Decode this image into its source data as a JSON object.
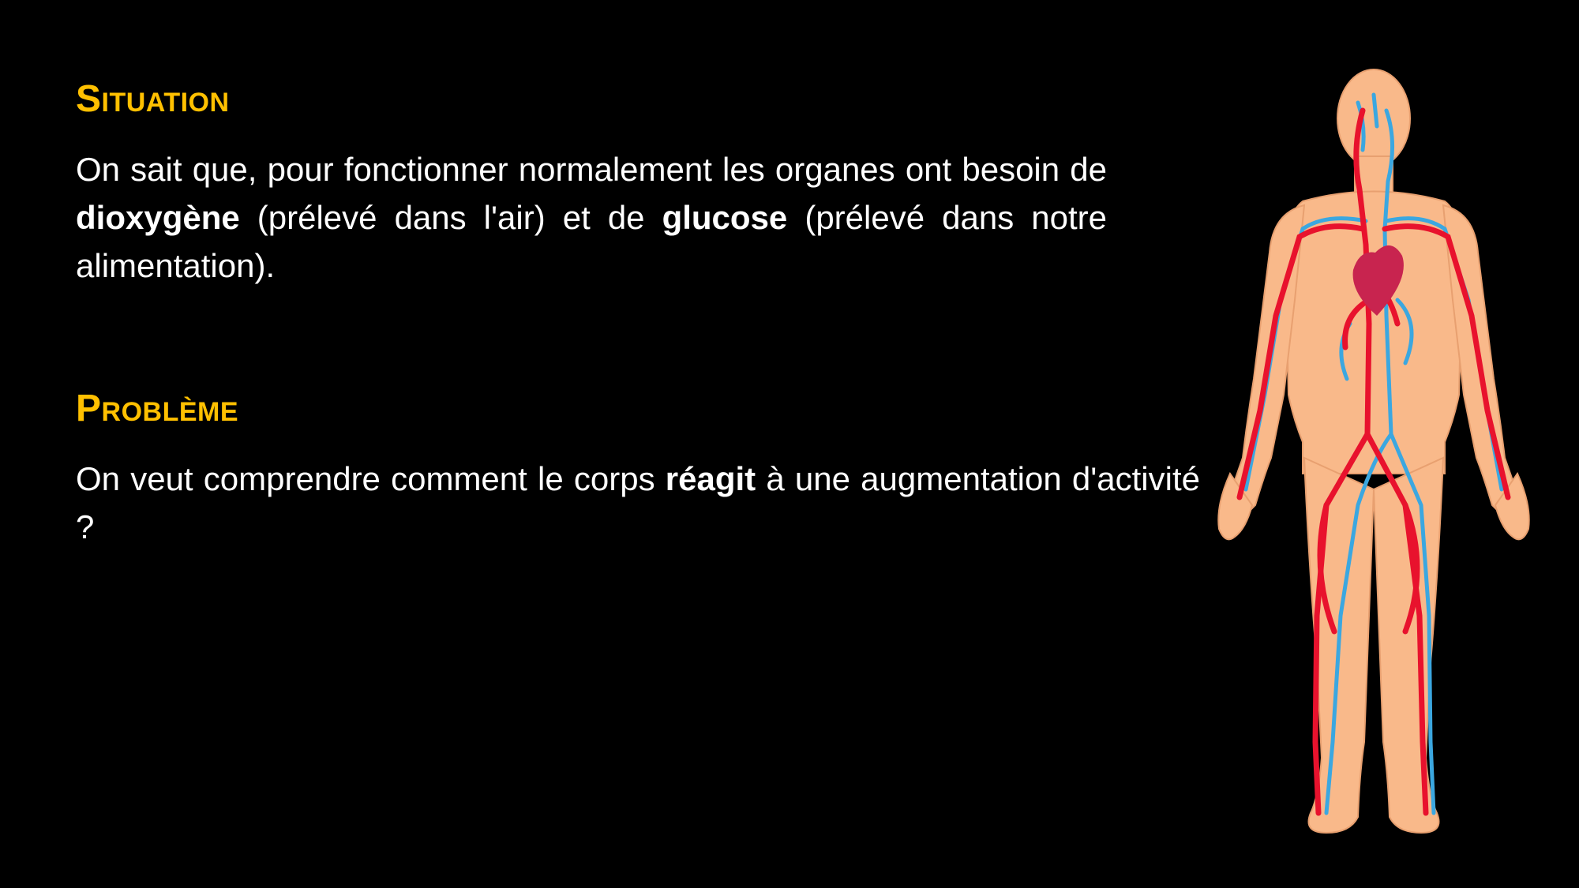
{
  "situation": {
    "heading": "Situation",
    "text_1": "On sait que, pour fonctionner normalement les organes ont besoin de ",
    "bold_1": "dioxygène",
    "text_2": " (prélevé dans l'air) et de ",
    "bold_2": "glucose",
    "text_3": " (prélevé dans notre alimentation)."
  },
  "probleme": {
    "heading": "Problème",
    "text_1": "On veut comprendre comment le corps ",
    "bold_1": "réagit",
    "text_2": " à une augmentation d'activité ?"
  },
  "illustration": {
    "icon": "circulatory-system-icon",
    "colors": {
      "skin": "#F9B98A",
      "skin_outline": "#E8A070",
      "artery": "#E8122D",
      "vein": "#3BA7E0",
      "heart": "#C8244F"
    }
  }
}
